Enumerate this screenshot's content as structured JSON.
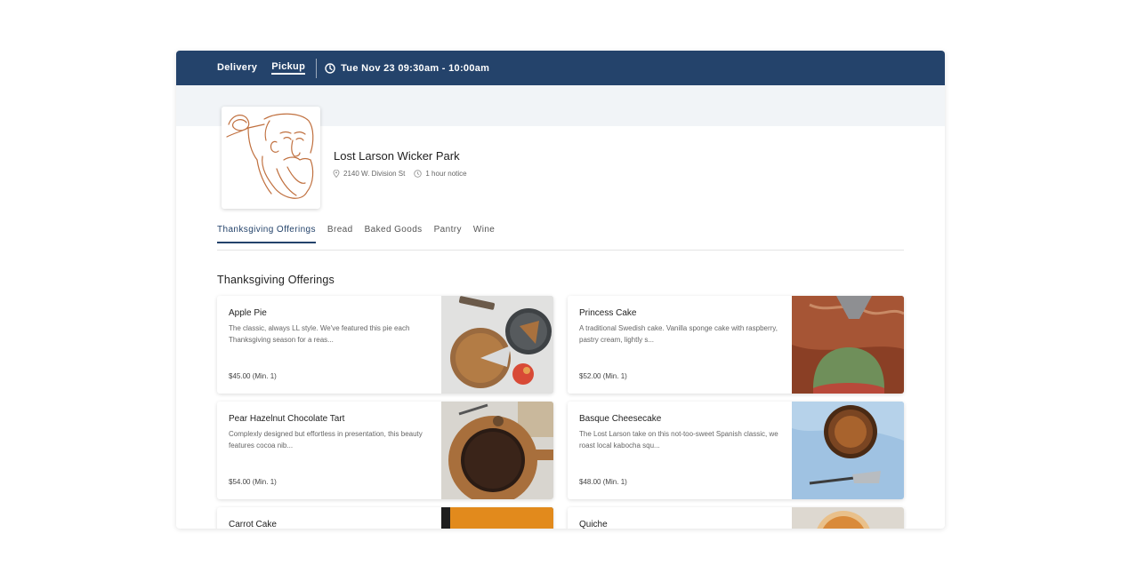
{
  "header": {
    "modes": [
      {
        "label": "Delivery",
        "active": false
      },
      {
        "label": "Pickup",
        "active": true
      }
    ],
    "time_label": "Tue Nov 23 09:30am - 10:00am"
  },
  "store": {
    "name": "Lost Larson Wicker Park",
    "address": "2140 W. Division St",
    "notice": "1 hour notice"
  },
  "tabs": [
    {
      "label": "Thanksgiving Offerings",
      "active": true
    },
    {
      "label": "Bread",
      "active": false
    },
    {
      "label": "Baked Goods",
      "active": false
    },
    {
      "label": "Pantry",
      "active": false
    },
    {
      "label": "Wine",
      "active": false
    }
  ],
  "section": {
    "title": "Thanksgiving Offerings"
  },
  "items": [
    {
      "name": "Apple Pie",
      "description": "The classic, always LL style. We've featured this pie each Thanksgiving season for a reas...",
      "price": "$45.00 (Min. 1)"
    },
    {
      "name": "Princess Cake",
      "description": "A traditional Swedish cake. Vanilla sponge cake with raspberry, pastry cream, lightly s...",
      "price": "$52.00 (Min. 1)"
    },
    {
      "name": "Pear Hazelnut Chocolate Tart",
      "description": "Complexly designed but effortless in presentation, this beauty features cocoa nib...",
      "price": "$54.00 (Min. 1)"
    },
    {
      "name": "Basque Cheesecake",
      "description": "The Lost Larson take on this not-too-sweet Spanish classic, we roast local kabocha squ...",
      "price": "$48.00 (Min. 1)"
    },
    {
      "name": "Carrot Cake",
      "description": "",
      "price": ""
    },
    {
      "name": "Quiche",
      "description": "",
      "price": ""
    }
  ],
  "colors": {
    "nav_bg": "#24436b",
    "banner_bg": "#f1f4f7",
    "logo_stroke": "#c0703f"
  },
  "icons": {
    "time": "clock-icon",
    "address": "location-pin-icon",
    "notice": "clock-icon"
  }
}
